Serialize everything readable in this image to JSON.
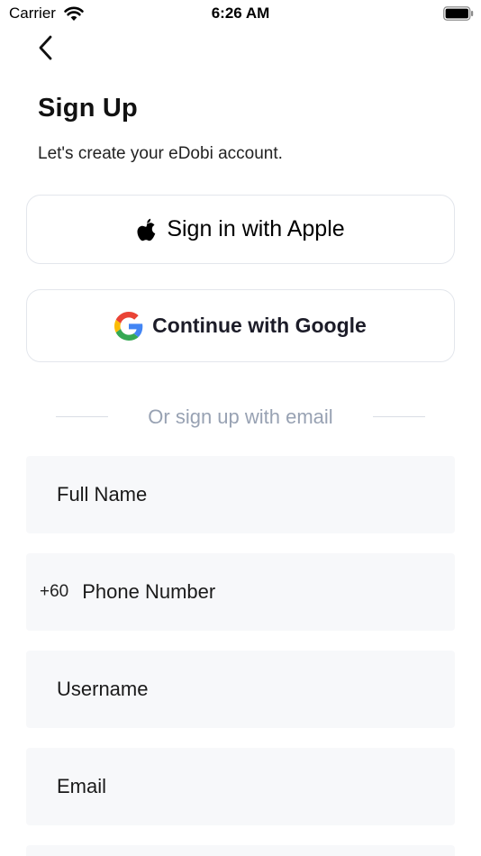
{
  "status_bar": {
    "carrier": "Carrier",
    "time": "6:26 AM"
  },
  "header": {
    "title": "Sign Up",
    "subtitle": "Let's create your eDobi account."
  },
  "social": {
    "apple_label": "Sign in with Apple",
    "google_label": "Continue with Google"
  },
  "divider": {
    "text": "Or sign up with email"
  },
  "form": {
    "full_name_placeholder": "Full Name",
    "country_code": "+60",
    "phone_placeholder": "Phone Number",
    "username_placeholder": "Username",
    "email_placeholder": "Email"
  },
  "icons": {
    "back": "chevron-left-icon",
    "apple": "apple-icon",
    "google": "google-icon",
    "wifi": "wifi-icon",
    "battery": "battery-icon"
  },
  "colors": {
    "border": "#e3e6ec",
    "field_bg": "#f7f8fa",
    "divider_text": "#98a2b3",
    "google_blue": "#4285F4",
    "google_red": "#EA4335",
    "google_yellow": "#FBBC05",
    "google_green": "#34A853"
  }
}
